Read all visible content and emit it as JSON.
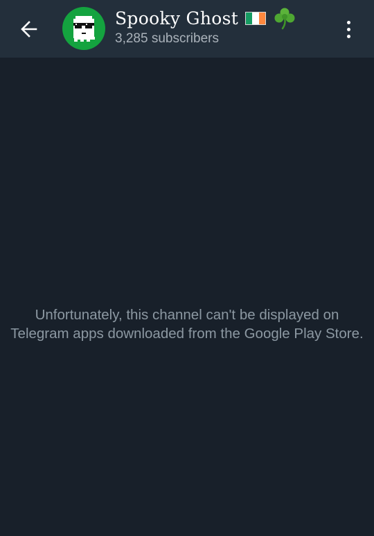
{
  "header": {
    "back_icon": "arrow-left-icon",
    "channel_name": "Spooky Ghost",
    "title_emoji": [
      "ireland-flag",
      "shamrock"
    ],
    "subscribers": "3,285 subscribers",
    "avatar_icon": "ghost-with-sunglasses-icon",
    "more_icon": "more-vertical-icon"
  },
  "main": {
    "notice": "Unfortunately, this channel can't be displayed on\nTelegram apps downloaded from the Google Play Store."
  },
  "colors": {
    "header_bg": "#232f3b",
    "page_bg": "#18202a",
    "avatar_bg": "#14a33f",
    "notice_text": "#8c98a2"
  }
}
